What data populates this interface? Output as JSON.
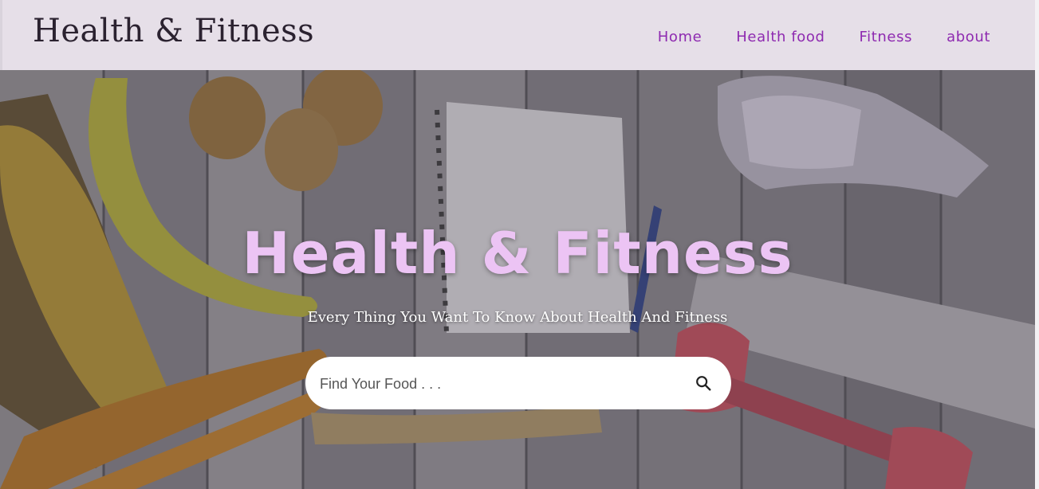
{
  "header": {
    "brand": "Health & Fitness",
    "nav": [
      {
        "label": "Home"
      },
      {
        "label": "Health food"
      },
      {
        "label": "Fitness"
      },
      {
        "label": "about"
      }
    ]
  },
  "hero": {
    "title": "Health & Fitness",
    "subtitle": "Every Thing You Want To Know About Health And Fitness",
    "search": {
      "placeholder": "Find Your Food . . .",
      "value": "",
      "icon": "search-icon"
    }
  },
  "colors": {
    "navbar_bg": "#e6dfe8",
    "nav_link": "#8e2ab0",
    "hero_title": "#ecc4f4",
    "brand_text": "#2b2230"
  }
}
